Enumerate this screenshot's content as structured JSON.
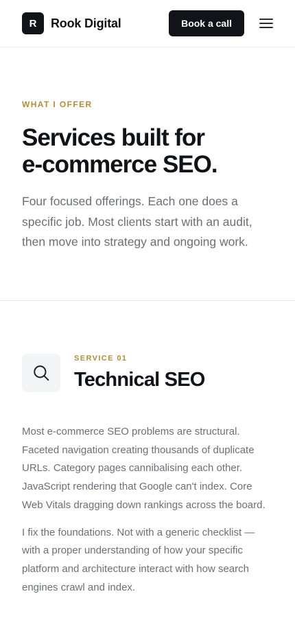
{
  "header": {
    "logo_letter": "R",
    "brand": "Rook Digital",
    "cta_label": "Book a call",
    "menu_icon": "hamburger-menu-icon"
  },
  "hero": {
    "eyebrow": "WHAT I OFFER",
    "title_line1": "Services built for",
    "title_line2": "e-commerce SEO.",
    "lead": "Four focused offerings. Each one does a specific job. Most clients start with an audit, then move into strategy and ongoing work."
  },
  "service": {
    "icon": "search-icon",
    "eyebrow": "SERVICE 01",
    "title": "Technical SEO",
    "paragraphs": [
      "Most e-commerce SEO problems are structural. Faceted navigation creating thousands of duplicate URLs. Category pages cannibalising each other. JavaScript rendering that Google can't index. Core Web Vitals dragging down rankings across the board.",
      "I fix the foundations. Not with a generic checklist — with a proper understanding of how your specific platform and architecture interact with how search engines crawl and index."
    ]
  },
  "colors": {
    "accent": "#b08d3c",
    "ink": "#111318",
    "muted": "#6b6f77",
    "border": "#e6e7ea",
    "icon_bg": "#f3f4f6"
  }
}
